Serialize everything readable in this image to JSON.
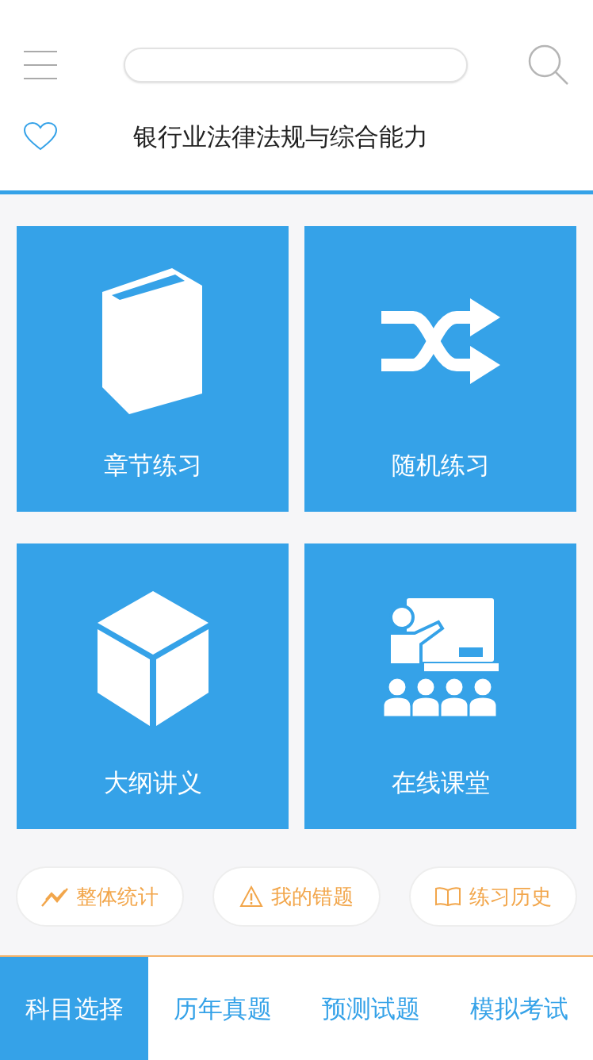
{
  "header": {
    "title": "银行业法律法规与综合能力"
  },
  "tiles": [
    {
      "kind": "book",
      "label": "章节练习"
    },
    {
      "kind": "shuffle",
      "label": "随机练习"
    },
    {
      "kind": "cube",
      "label": "大纲讲义"
    },
    {
      "kind": "classroom",
      "label": "在线课堂"
    }
  ],
  "quick_actions": [
    {
      "kind": "stats",
      "label": "整体统计"
    },
    {
      "kind": "warning",
      "label": "我的错题"
    },
    {
      "kind": "book",
      "label": "练习历史"
    }
  ],
  "tabs": [
    {
      "label": "科目选择",
      "selected": true
    },
    {
      "label": "历年真题",
      "selected": false
    },
    {
      "label": "预测试题",
      "selected": false
    },
    {
      "label": "模拟考试",
      "selected": false
    }
  ]
}
